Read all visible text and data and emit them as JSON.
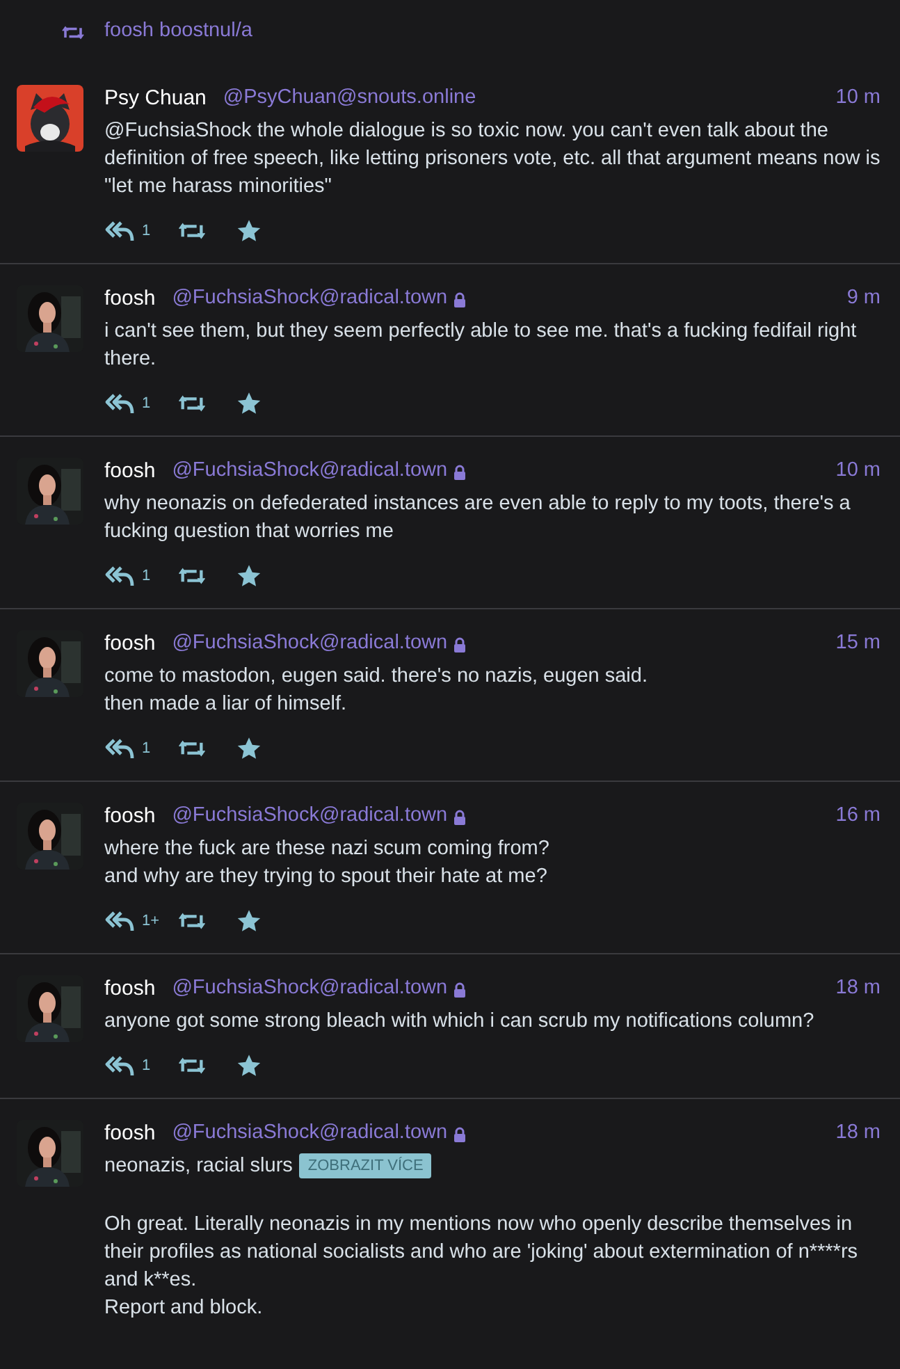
{
  "boost_banner": {
    "text": "foosh boostnul/a"
  },
  "posts": [
    {
      "display_name": "Psy Chuan",
      "handle": "@PsyChuan@snouts.online",
      "locked": false,
      "time": "10 m",
      "content": [
        "@FuchsiaShock the whole dialogue is so toxic now. you can't even talk about the definition of free speech, like letting prisoners vote, etc. all that argument means now is \"let me harass minorities\""
      ],
      "replies_count": "1"
    },
    {
      "display_name": "foosh",
      "handle": "@FuchsiaShock@radical.town",
      "locked": true,
      "time": "9 m",
      "content": [
        "i can't see them, but they seem perfectly able to see me. that's a fucking fedifail right there."
      ],
      "replies_count": "1"
    },
    {
      "display_name": "foosh",
      "handle": "@FuchsiaShock@radical.town",
      "locked": true,
      "time": "10 m",
      "content": [
        "why neonazis on defederated instances are even able to reply to my toots, there's a fucking question that worries me"
      ],
      "replies_count": "1"
    },
    {
      "display_name": "foosh",
      "handle": "@FuchsiaShock@radical.town",
      "locked": true,
      "time": "15 m",
      "content": [
        "come to mastodon, eugen said. there's no nazis, eugen said.",
        "then made a liar of himself."
      ],
      "replies_count": "1"
    },
    {
      "display_name": "foosh",
      "handle": "@FuchsiaShock@radical.town",
      "locked": true,
      "time": "16 m",
      "content": [
        "where the fuck are these nazi scum coming from?",
        "and why are they trying to spout their hate at me?"
      ],
      "replies_count": "1+"
    },
    {
      "display_name": "foosh",
      "handle": "@FuchsiaShock@radical.town",
      "locked": true,
      "time": "18 m",
      "content": [
        "anyone got some strong bleach with which i can scrub my notifications column?"
      ],
      "replies_count": "1"
    },
    {
      "display_name": "foosh",
      "handle": "@FuchsiaShock@radical.town",
      "locked": true,
      "time": "18 m",
      "spoiler": {
        "text": "neonazis, racial slurs",
        "button": "ZOBRAZIT VÍCE"
      },
      "content": [
        "Oh great. Literally neonazis in my mentions now who openly describe themselves in their profiles as national socialists and who are 'joking' about extermination of n****rs and k**es.",
        "Report and block."
      ]
    }
  ]
}
